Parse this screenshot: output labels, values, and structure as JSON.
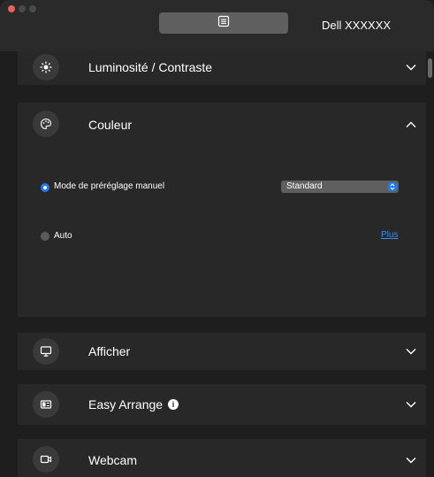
{
  "header": {
    "monitor_name": "Dell XXXXXX",
    "tab_icon": "list-document-icon"
  },
  "sections": {
    "brightness": {
      "title": "Luminosité / Contraste",
      "icon": "sun-icon",
      "expanded": false
    },
    "color": {
      "title": "Couleur",
      "icon": "palette-icon",
      "expanded": true,
      "manual_mode_label": "Mode de préréglage manuel",
      "manual_mode_selected": true,
      "preset_value": "Standard",
      "auto_label": "Auto",
      "auto_selected": false,
      "more_link": "Plus"
    },
    "display": {
      "title": "Afficher",
      "icon": "monitor-icon",
      "expanded": false
    },
    "easy_arrange": {
      "title": "Easy Arrange",
      "icon": "layout-icon",
      "info_icon": "info-icon",
      "expanded": false
    },
    "webcam": {
      "title": "Webcam",
      "icon": "camera-icon",
      "expanded": false
    }
  },
  "colors": {
    "accent": "#1f7af5",
    "link": "#3a8ee6",
    "panel": "#282828",
    "background": "#1e1e1e"
  }
}
